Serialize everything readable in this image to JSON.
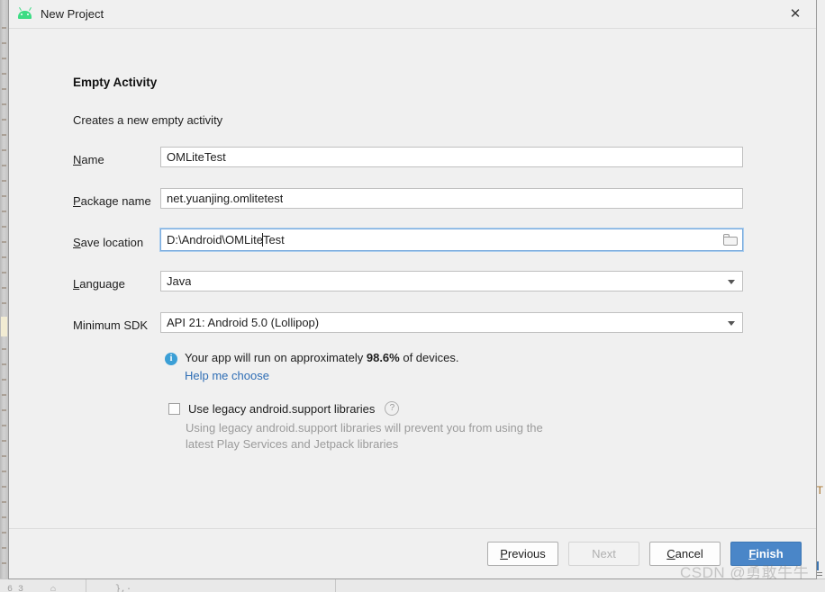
{
  "window": {
    "title": "New Project",
    "icon": "android-robot-icon",
    "close_label": "✕"
  },
  "content": {
    "heading": "Empty Activity",
    "subheading": "Creates a new empty activity"
  },
  "form": {
    "fields": [
      {
        "name": "name",
        "label_prefix": "",
        "label_mnemonic": "N",
        "label_suffix": "ame",
        "value": "OMLiteTest",
        "type": "text"
      },
      {
        "name": "package-name",
        "label_prefix": "",
        "label_mnemonic": "P",
        "label_suffix": "ackage name",
        "value": "net.yuanjing.omlitetest",
        "type": "text"
      },
      {
        "name": "save-location",
        "label_prefix": "",
        "label_mnemonic": "S",
        "label_suffix": "ave location",
        "value_before_caret": "D:\\Android\\OMLite",
        "value_after_caret": "Test",
        "value": "D:\\Android\\OMLiteTest",
        "type": "path",
        "focused": true,
        "browse_icon": "folder-icon"
      },
      {
        "name": "language",
        "label_prefix": "",
        "label_mnemonic": "L",
        "label_suffix": "anguage",
        "value": "Java",
        "type": "combo",
        "arrow_icon": "chevron-down-icon"
      },
      {
        "name": "minimum-sdk",
        "label_prefix": "Minimum SDK",
        "label_mnemonic": "",
        "label_suffix": "",
        "value": "API 21: Android 5.0 (Lollipop)",
        "type": "combo",
        "arrow_icon": "chevron-down-icon"
      }
    ]
  },
  "info": {
    "icon": "info-icon",
    "text_before": "Your app will run on approximately ",
    "percent": "98.6%",
    "text_after": " of devices.",
    "link": "Help me choose"
  },
  "legacy": {
    "checkbox_label": "Use legacy android.support libraries",
    "checked": false,
    "help_icon": "question-mark-icon",
    "description": "Using legacy android.support libraries will prevent you from using the latest Play Services and Jetpack libraries"
  },
  "footer": {
    "buttons": [
      {
        "name": "previous",
        "mnemonic": "P",
        "before": "",
        "after": "revious",
        "state": "enabled",
        "style": "default"
      },
      {
        "name": "next",
        "mnemonic": "",
        "before": "Next",
        "after": "",
        "state": "disabled",
        "style": "default"
      },
      {
        "name": "cancel",
        "mnemonic": "C",
        "before": "",
        "after": "ancel",
        "state": "enabled",
        "style": "default"
      },
      {
        "name": "finish",
        "mnemonic": "F",
        "before": "",
        "after": "inish",
        "state": "enabled",
        "style": "primary"
      }
    ]
  },
  "watermark": {
    "text": "CSDN @勇敢牛牛"
  },
  "background": {
    "right_marker": "T",
    "bottom_fragments": [
      "6 3",
      "⌂",
      "},·"
    ]
  },
  "colors": {
    "accent_blue": "#4a86c8",
    "link_blue": "#2f6eb5",
    "info_blue": "#3b9fd6",
    "android_green": "#3ddc84",
    "dialog_bg": "#f0f0f0",
    "field_bg": "#ffffff",
    "focus_border": "#7aabdd",
    "muted_text": "#9b9b9b"
  }
}
